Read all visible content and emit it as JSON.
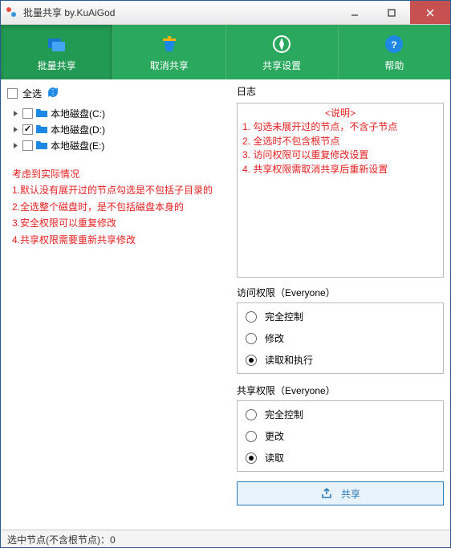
{
  "window": {
    "title": "批量共享 by.KuAiGod"
  },
  "toolbar": {
    "batch": "批量共享",
    "cancel": "取消共享",
    "settings": "共享设置",
    "help": "帮助"
  },
  "left": {
    "select_all": "全选",
    "drives": [
      {
        "label": "本地磁盘(C:)",
        "checked": false
      },
      {
        "label": "本地磁盘(D:)",
        "checked": true
      },
      {
        "label": "本地磁盘(E:)",
        "checked": false
      }
    ],
    "note": {
      "title": "考虑到实际情况",
      "l1": "1.默认没有展开过的节点勾选是不包括子目录的",
      "l2": "2.全选整个磁盘时，是不包括磁盘本身的",
      "l3": "3.安全权限可以重复修改",
      "l4": "4.共享权限需要重新共享修改"
    }
  },
  "right": {
    "log_label": "日志",
    "log": {
      "title": "<说明>",
      "l1": "1. 勾选未展开过的节点，不含子节点",
      "l2": "2. 全选时不包含根节点",
      "l3": "3. 访问权限可以重复修改设置",
      "l4": "4. 共享权限需取消共享后重新设置"
    },
    "access": {
      "label": "访问权限（Everyone）",
      "opts": {
        "full": "完全控制",
        "modify": "修改",
        "readexec": "读取和执行"
      },
      "selected": "readexec"
    },
    "share": {
      "label": "共享权限（Everyone）",
      "opts": {
        "full": "完全控制",
        "change": "更改",
        "read": "读取"
      },
      "selected": "read"
    },
    "share_button": "共享"
  },
  "status": {
    "text": "选中节点(不含根节点)：0"
  }
}
